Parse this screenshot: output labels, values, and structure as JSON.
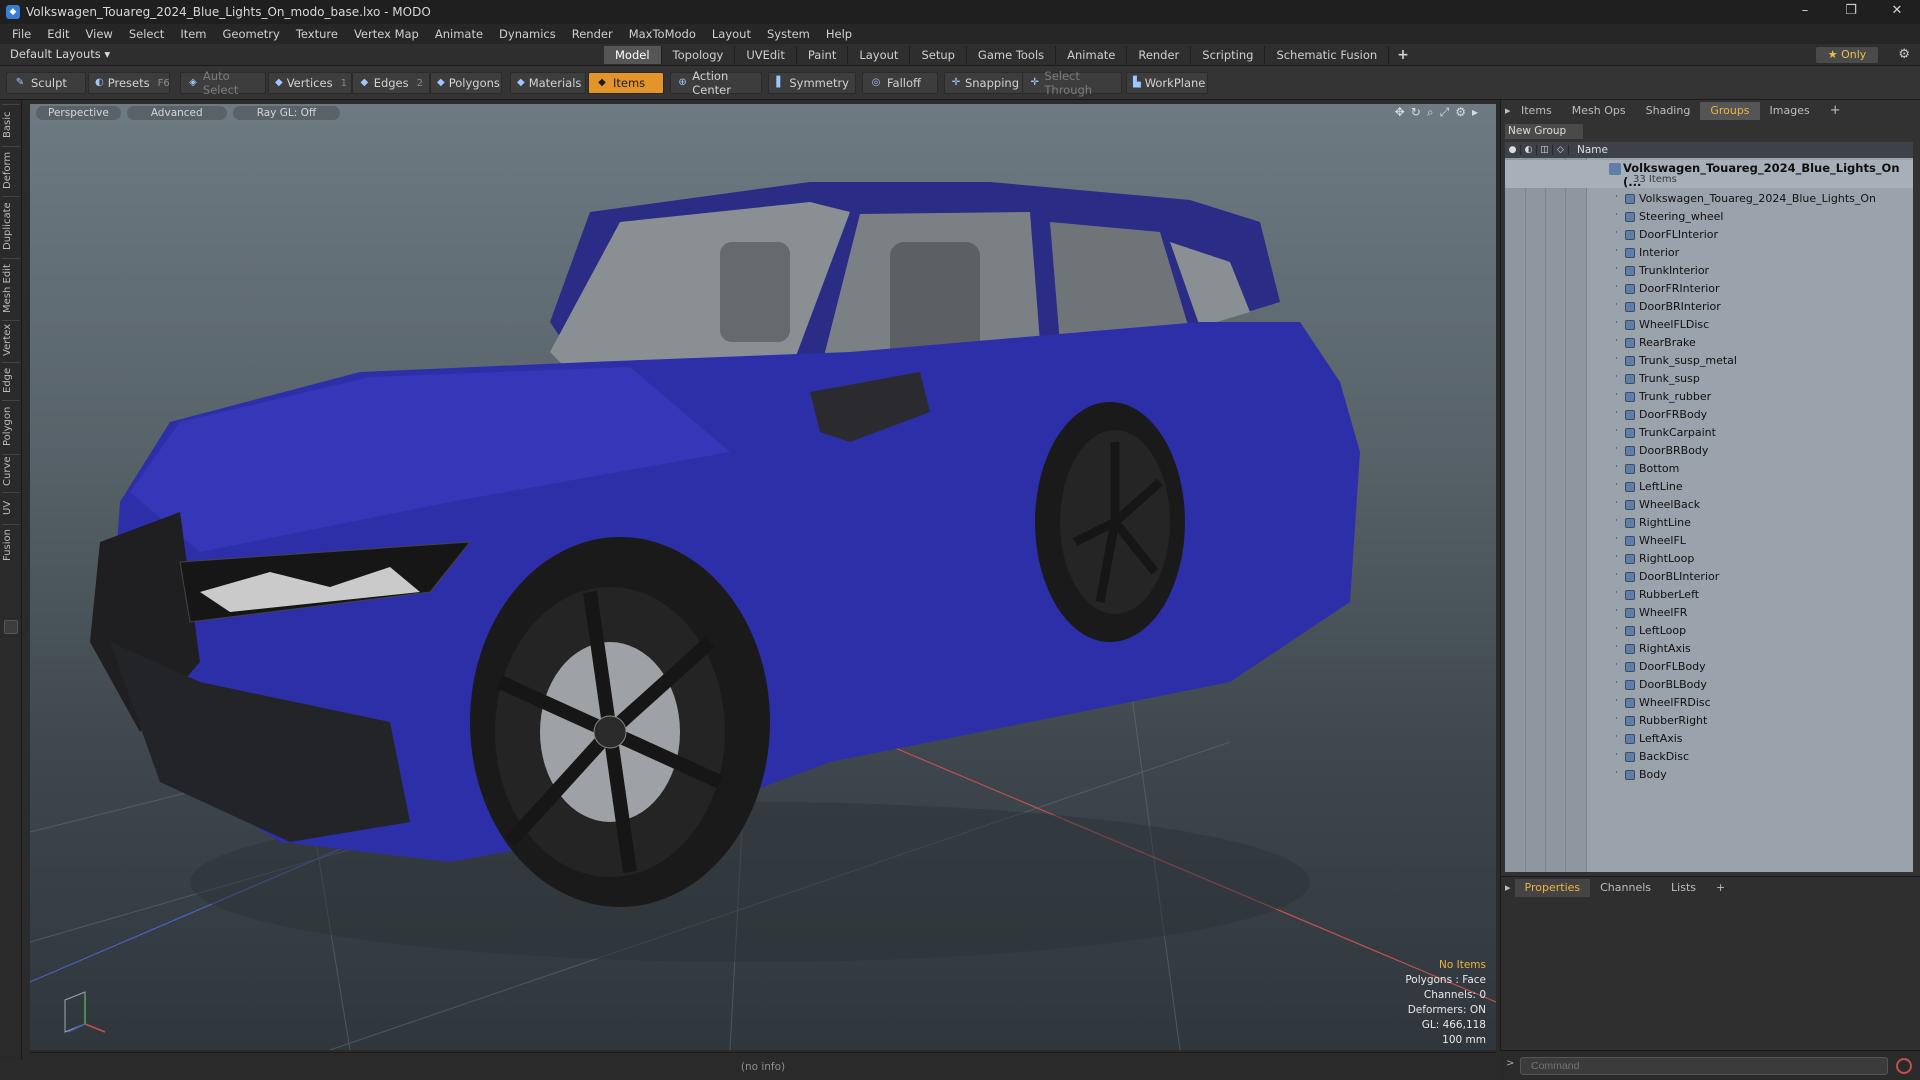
{
  "window": {
    "title": "Volkswagen_Touareg_2024_Blue_Lights_On_modo_base.lxo - MODO",
    "controls": [
      "–",
      "❐",
      "✕"
    ]
  },
  "menu": [
    "File",
    "Edit",
    "View",
    "Select",
    "Item",
    "Geometry",
    "Texture",
    "Vertex Map",
    "Animate",
    "Dynamics",
    "Render",
    "MaxToModo",
    "Layout",
    "System",
    "Help"
  ],
  "layouts": {
    "default_label": "Default Layouts ▾",
    "tabs": [
      "Model",
      "Topology",
      "UVEdit",
      "Paint",
      "Layout",
      "Setup",
      "Game Tools",
      "Animate",
      "Render",
      "Scripting",
      "Schematic Fusion"
    ],
    "active_tab": "Model",
    "plus": "+",
    "only_label": "★ Only"
  },
  "toolbar": {
    "sculpt": "Sculpt",
    "presets": "Presets",
    "presets_key": "F6",
    "auto_select": "Auto Select",
    "vertices": "Vertices",
    "vertices_count": "1",
    "edges": "Edges",
    "edges_count": "2",
    "polygons": "Polygons",
    "materials": "Materials",
    "items": "Items",
    "action_center": "Action Center",
    "symmetry": "Symmetry",
    "falloff": "Falloff",
    "snapping": "Snapping",
    "select_through": "Select Through",
    "workplane": "WorkPlane"
  },
  "left_tabs": [
    "Basic",
    "Deform",
    "Duplicate",
    "Mesh Edit",
    "Vertex",
    "Edge",
    "Polygon",
    "Curve",
    "UV",
    "Fusion"
  ],
  "viewport": {
    "perspective": "Perspective",
    "advanced": "Advanced",
    "raygl": "Ray GL: Off",
    "stats": {
      "no_items": "No Items",
      "polygons": "Polygons : Face",
      "channels": "Channels: 0",
      "deformers": "Deformers: ON",
      "gl": "GL: 466,118",
      "scale": "100 mm"
    },
    "status": "(no info)",
    "colors": {
      "car_body": "#2d2fa8",
      "tire": "#1a1a1a",
      "rim": "#222222"
    }
  },
  "right_panel": {
    "tabs": [
      "Items",
      "Mesh Ops",
      "Shading",
      "Groups",
      "Images"
    ],
    "active_tab": "Groups",
    "plus": "+",
    "new_group": "New Group",
    "column_name": "Name",
    "root_name": "Volkswagen_Touareg_2024_Blue_Lights_On (...",
    "root_count": "33 Items",
    "items": [
      "Volkswagen_Touareg_2024_Blue_Lights_On",
      "Steering_wheel",
      "DoorFLInterior",
      "Interior",
      "TrunkInterior",
      "DoorFRInterior",
      "DoorBRInterior",
      "WheelFLDisc",
      "RearBrake",
      "Trunk_susp_metal",
      "Trunk_susp",
      "Trunk_rubber",
      "DoorFRBody",
      "TrunkCarpaint",
      "DoorBRBody",
      "Bottom",
      "LeftLine",
      "WheelBack",
      "RightLine",
      "WheelFL",
      "RightLoop",
      "DoorBLInterior",
      "RubberLeft",
      "WheelFR",
      "LeftLoop",
      "RightAxis",
      "DoorFLBody",
      "DoorBLBody",
      "WheelFRDisc",
      "RubberRight",
      "LeftAxis",
      "BackDisc",
      "Body"
    ]
  },
  "properties": {
    "tabs": [
      "Properties",
      "Channels",
      "Lists"
    ],
    "active_tab": "Properties",
    "plus": "+"
  },
  "command": {
    "placeholder": "Command",
    "arrow": ">"
  }
}
